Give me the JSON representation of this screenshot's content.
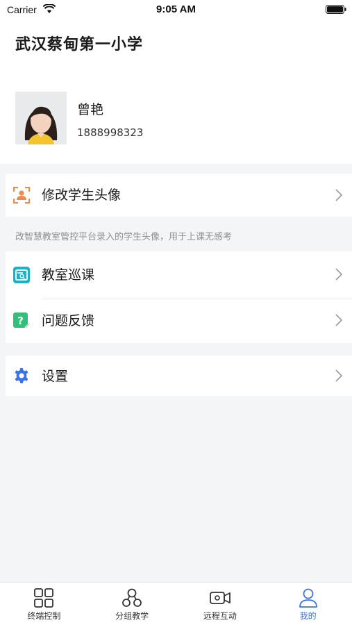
{
  "status_bar": {
    "carrier": "Carrier",
    "time": "9:05 AM"
  },
  "header": {
    "school_name": "武汉蔡甸第一小学"
  },
  "profile": {
    "name": "曾艳",
    "phone": "1888998323"
  },
  "menu": {
    "edit_avatar": {
      "label": "修改学生头像",
      "icon": "person-frame-icon"
    },
    "hint": "改智慧教室管控平台录入的学生头像，用于上课无感考",
    "classroom_patrol": {
      "label": "教室巡课",
      "icon": "patrol-monitor-icon"
    },
    "feedback": {
      "label": "问题反馈",
      "icon": "question-feedback-icon"
    },
    "settings": {
      "label": "设置",
      "icon": "gear-icon"
    }
  },
  "tab_bar": {
    "tabs": [
      {
        "label": "终端控制",
        "icon": "grid-icon"
      },
      {
        "label": "分组教学",
        "icon": "group-icon"
      },
      {
        "label": "远程互动",
        "icon": "video-camera-icon"
      },
      {
        "label": "我的",
        "icon": "user-icon",
        "active": true
      }
    ]
  },
  "colors": {
    "accent": "#3b73e8",
    "orange": "#f08a4b",
    "teal": "#1ab3c6",
    "green": "#2fc07a",
    "blue": "#3b73e8"
  }
}
